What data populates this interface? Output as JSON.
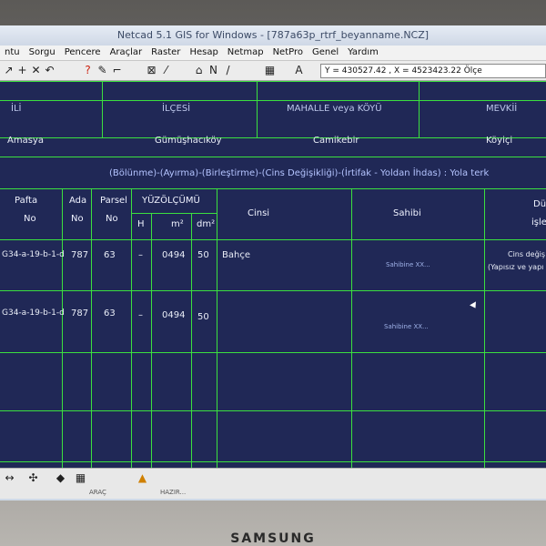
{
  "window": {
    "title": "Netcad 5.1 GIS for Windows - [787a63p_rtrf_beyanname.NCZ]"
  },
  "menu": [
    "ntu",
    "Sorgu",
    "Pencere",
    "Araçlar",
    "Raster",
    "Hesap",
    "Netmap",
    "NetPro",
    "Genel",
    "Yardım"
  ],
  "toolbar": {
    "coords": "Y = 430527.42 , X = 4523423.22  Ölçe",
    "icons": [
      "pointer-icon",
      "plus-icon",
      "cross-icon",
      "help-icon",
      "redo-icon",
      "pen-icon",
      "text-icon"
    ]
  },
  "sheet": {
    "top_labels": [
      "İLİ",
      "İLÇESİ",
      "MAHALLE veya KÖYÜ",
      "MEVKİİ"
    ],
    "location_values": [
      "Amasya",
      "Gümüşhacıköy",
      "Camikebir",
      "Köyiçi"
    ],
    "operation_line": "(Bölünme)-(Ayırma)-(Birleştirme)-(Cins Değişikliği)-(İrtifak - Yoldan İhdas) : Yola terk",
    "col_headers": {
      "pafta": "Pafta",
      "pafta_no": "No",
      "ada": "Ada",
      "ada_no": "No",
      "parsel": "Parsel",
      "parsel_no": "No",
      "yuzolcumu": "YÜZÖLÇÜMÜ",
      "h": "H",
      "m2": "m²",
      "dm2": "dm²",
      "cinsi": "Cinsi",
      "sahibi": "Sahibi",
      "last": "Dü",
      "last2": "işle"
    },
    "rows": [
      {
        "pafta": "G34-a-19-b-1-d",
        "ada": "787",
        "parsel": "63",
        "h": "–",
        "m2": "0494",
        "dm2": "50",
        "cinsi": "Bahçe",
        "sahibi": "Sahibine XX...",
        "note1": "Cins değiş",
        "note2": "(Yapısız ve yapı"
      },
      {
        "pafta": "G34-a-19-b-1-d",
        "ada": "787",
        "parsel": "63",
        "h": "–",
        "m2": "0494",
        "dm2": "50",
        "cinsi": "",
        "sahibi": "Sahibine XX...",
        "note1": "",
        "note2": ""
      }
    ]
  },
  "bottom": {
    "label1": "ARAÇ",
    "label2": "HAZIR..."
  },
  "brand": "SAMSUNG"
}
